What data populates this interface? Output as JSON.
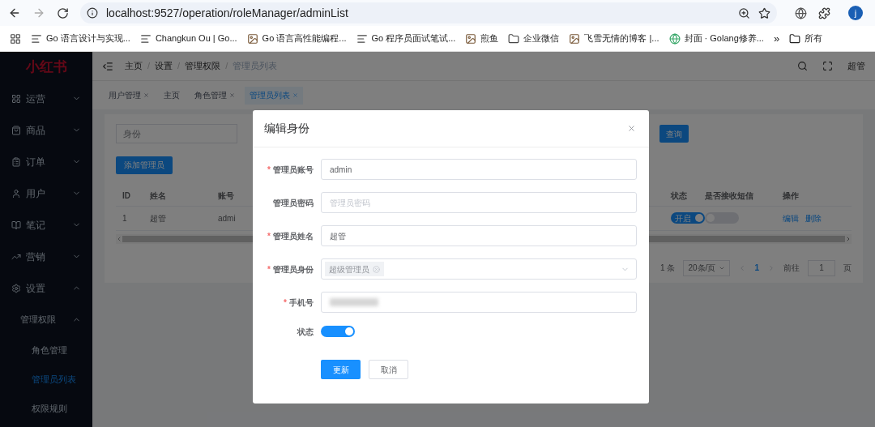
{
  "browser": {
    "url": "localhost:9527/operation/roleManager/adminList",
    "avatar": "j",
    "bookmarks": [
      {
        "label": "Go 语言设计与实现..."
      },
      {
        "label": "Changkun Ou | Go..."
      },
      {
        "label": "Go 语言高性能编程..."
      },
      {
        "label": "Go 程序员面试笔试..."
      },
      {
        "label": "煎鱼"
      },
      {
        "label": "企业微信"
      },
      {
        "label": "飞雪无情的博客 |..."
      },
      {
        "label": "封面 · Golang修养..."
      }
    ],
    "more": "»",
    "folder": "所有"
  },
  "sidebar": {
    "logo": "小红书",
    "items": [
      {
        "label": "运营",
        "expanded": false
      },
      {
        "label": "商品",
        "expanded": false
      },
      {
        "label": "订单",
        "expanded": false
      },
      {
        "label": "用户",
        "expanded": false
      },
      {
        "label": "笔记",
        "expanded": false
      },
      {
        "label": "营销",
        "expanded": false
      },
      {
        "label": "设置",
        "expanded": true,
        "children": [
          {
            "label": "管理权限",
            "expanded": true,
            "children": [
              {
                "label": "角色管理",
                "selected": false
              },
              {
                "label": "管理员列表",
                "selected": true
              },
              {
                "label": "权限规则",
                "selected": false
              }
            ]
          }
        ]
      }
    ]
  },
  "header": {
    "separator": "/",
    "breadcrumbs": [
      {
        "label": "主页",
        "current": false
      },
      {
        "label": "设置",
        "current": false
      },
      {
        "label": "管理权限",
        "current": false
      },
      {
        "label": "管理员列表",
        "current": true
      }
    ],
    "user": "超管"
  },
  "tags": [
    {
      "label": "用户管理",
      "selected": false,
      "closable": true
    },
    {
      "label": "主页",
      "selected": false,
      "closable": false
    },
    {
      "label": "角色管理",
      "selected": false,
      "closable": true
    },
    {
      "label": "管理员列表",
      "selected": true,
      "closable": true
    }
  ],
  "search": {
    "placeholder": "身份",
    "query_button": "查询"
  },
  "add_button": "添加管理员",
  "table": {
    "columns": [
      "ID",
      "姓名",
      "账号",
      "状态",
      "是否接收短信",
      "操作"
    ],
    "rows": [
      {
        "id": "1",
        "name": "超管",
        "account": "admi",
        "status": {
          "label": "开启",
          "on": true
        },
        "sms": {
          "on": false
        },
        "actions": [
          "编辑",
          "删除"
        ]
      }
    ]
  },
  "pagination": {
    "total": "1 条",
    "page_size": "20条/页",
    "pages": [
      {
        "label": "1",
        "selected": true
      }
    ],
    "goto_label": "前往",
    "goto_value": "1",
    "page_suffix": "页"
  },
  "dialog": {
    "title": "编辑身份",
    "required_mark": "*",
    "fields": [
      {
        "kind": "text",
        "label": "管理员账号",
        "required": true,
        "value": "admin"
      },
      {
        "kind": "text",
        "label": "管理员密码",
        "required": false,
        "placeholder": "管理员密码"
      },
      {
        "kind": "text",
        "label": "管理员姓名",
        "required": true,
        "value": "超管"
      },
      {
        "kind": "select",
        "label": "管理员身份",
        "required": true,
        "tags": [
          "超级管理员"
        ]
      },
      {
        "kind": "blurred",
        "label": "手机号",
        "required": true
      },
      {
        "kind": "switch",
        "label": "状态",
        "required": false,
        "on": true
      }
    ],
    "buttons": [
      {
        "label": "更新",
        "primary": true
      },
      {
        "label": "取消",
        "primary": false
      }
    ]
  }
}
